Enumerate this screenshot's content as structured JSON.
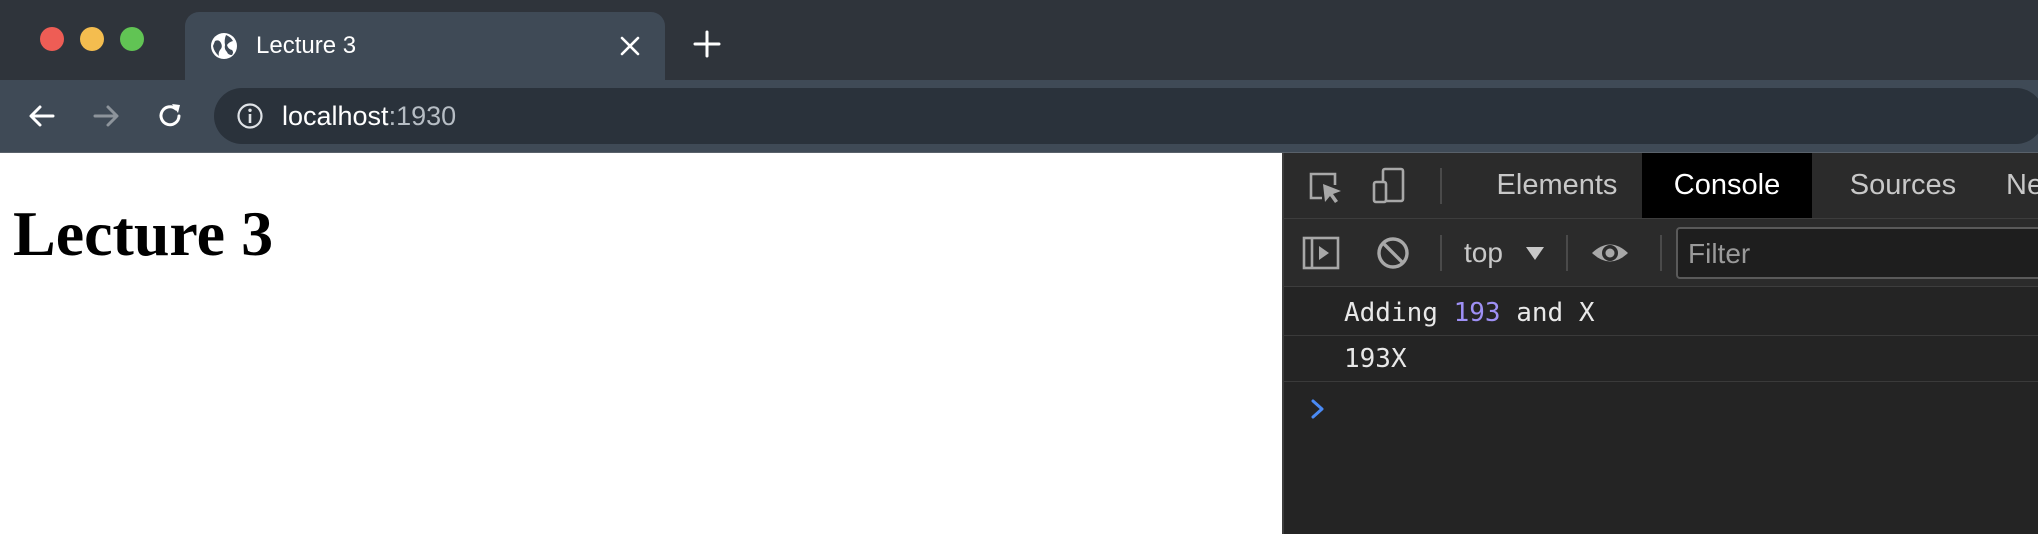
{
  "browser": {
    "tab": {
      "title": "Lecture 3",
      "icon": "globe-icon"
    },
    "address": {
      "host": "localhost",
      "port": ":1930",
      "icon": "info-icon"
    },
    "colors": {
      "traffic_close": "#ee5d55",
      "traffic_minimize": "#f4bd4f",
      "traffic_zoom": "#61c454",
      "tabstrip_bg": "#2f343b",
      "toolbar_bg": "#3f4a56"
    }
  },
  "page": {
    "heading": "Lecture 3"
  },
  "devtools": {
    "tabs": [
      {
        "label": "Elements",
        "active": false
      },
      {
        "label": "Console",
        "active": true
      },
      {
        "label": "Sources",
        "active": false
      },
      {
        "label": "Ne",
        "active": false
      }
    ],
    "console_toolbar": {
      "context": "top",
      "filter_placeholder": "Filter"
    },
    "console_messages": [
      {
        "prefix": "Adding ",
        "number": "193",
        "suffix": " and X"
      },
      {
        "text": "193X"
      }
    ],
    "colors": {
      "number": "#9e90f5",
      "prompt": "#4a8af4",
      "active_tab_bg": "#000000"
    }
  }
}
